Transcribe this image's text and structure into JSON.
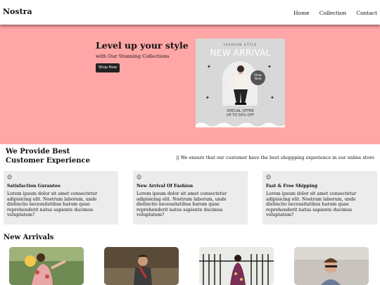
{
  "header": {
    "brand": "Nostra",
    "nav": [
      "Home",
      "Collection",
      "Contact"
    ]
  },
  "hero": {
    "title": "Level up your style",
    "subtitle": "with Our Stunning Collections",
    "button_label": "Shop Now",
    "background_color": "#ffa6a6",
    "poster": {
      "tag": "FASHION STYLE",
      "headline": "NEW ARRIVAL",
      "badge": "Shop Now",
      "offer_line1": "SPECIAL OFFER",
      "offer_line2": "UP TO 50% OFF"
    }
  },
  "provide": {
    "title": "We Provide Best Customer Experience",
    "note": "|| We ensure that our customer have the best shoppping experience in our online store"
  },
  "features": [
    {
      "icon": "smiley-icon",
      "glyph": "☺",
      "title": "Satisfaction Gurantee",
      "body": "Lorem ipsum dolor sit amet consectetur adipisicing elit. Nostrum laborum, unde distinctio necessitatibus harum quae reprehenderit natus sapiente ducimus voluptatem?"
    },
    {
      "icon": "smiley-icon",
      "glyph": "☺",
      "title": "New Arrival Of Fashion",
      "body": "Lorem ipsum dolor sit amet consectetur adipisicing elit. Nostrum laborum, unde distinctio necessitatibus harum quae reprehenderit natus sapiente ducimus voluptatem?"
    },
    {
      "icon": "smiley-icon",
      "glyph": "☺",
      "title": "Fast & Free Shipping",
      "body": "Lorem ipsum dolor sit amet consectetur adipisicing elit. Nostrum laborum, unde distinctio necessitatibus harum quae reprehenderit natus sapiente ducimus voluptatem?"
    }
  ],
  "arrivals": {
    "title": "New Arrivals"
  }
}
